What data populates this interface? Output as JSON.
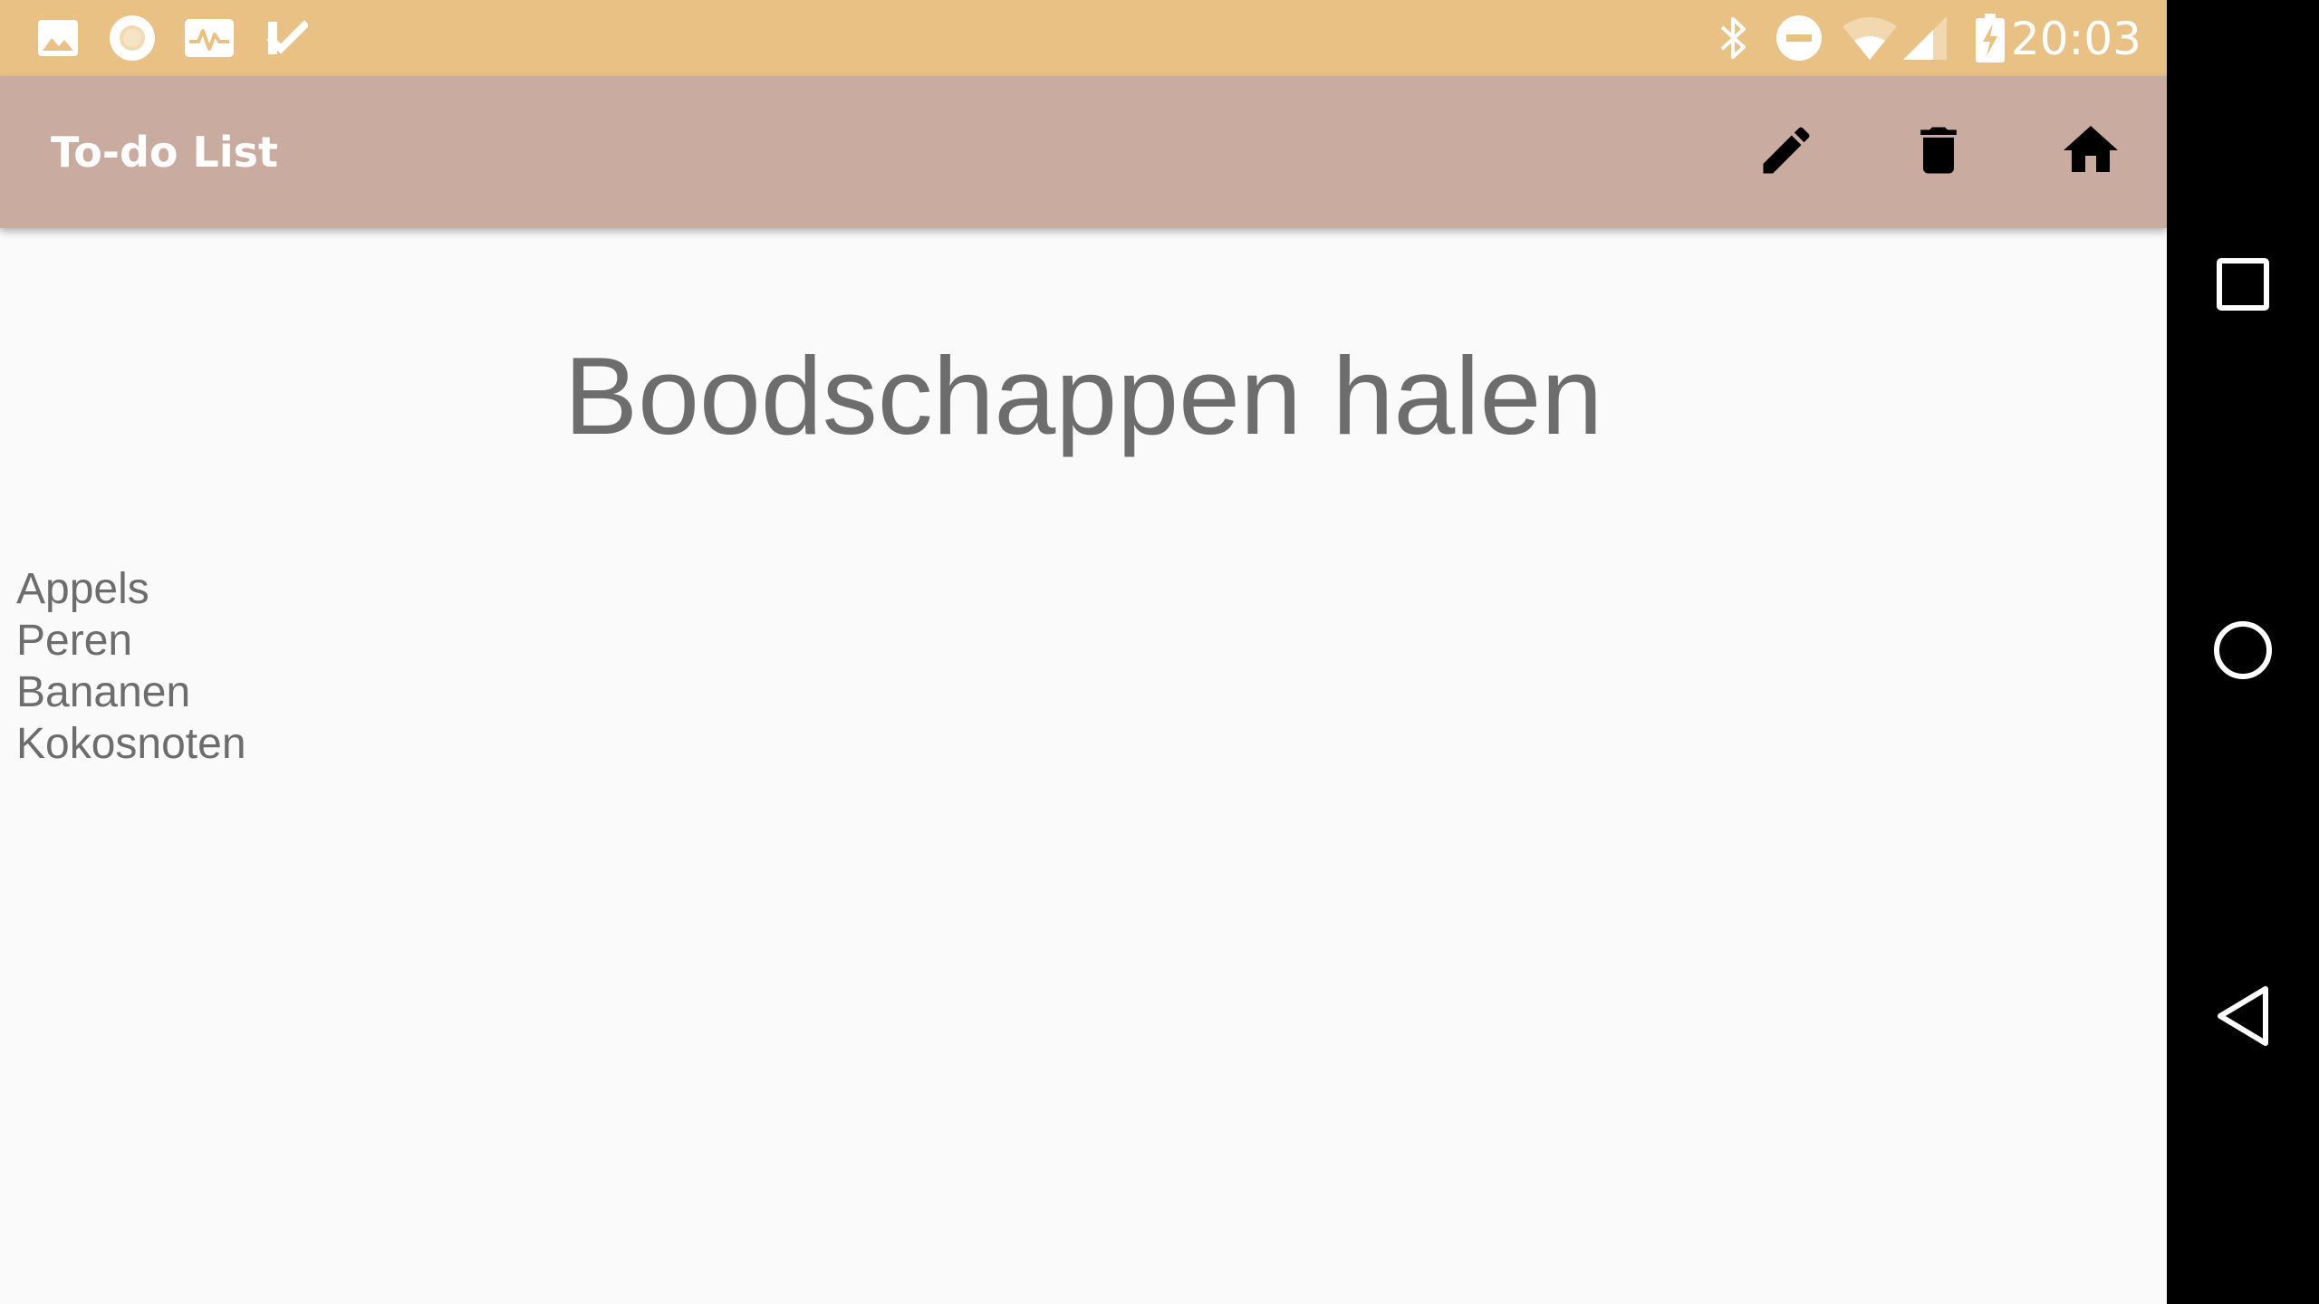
{
  "status_bar": {
    "time": "20:03",
    "left_icons": [
      "image-icon",
      "circle-notification-icon",
      "activity-chart-icon",
      "checklist-icon"
    ],
    "right_icons": [
      "bluetooth-icon",
      "do-not-disturb-icon",
      "wifi-icon",
      "cell-signal-icon",
      "battery-charging-icon"
    ],
    "background": "#e9c185"
  },
  "app_bar": {
    "title": "To-do List",
    "actions": [
      "pencil-icon",
      "trash-icon",
      "home-icon"
    ],
    "background": "#caaba0"
  },
  "list": {
    "title": "Boodschappen halen",
    "items": [
      "Appels",
      "Peren",
      "Bananen",
      "Kokosnoten"
    ]
  },
  "nav_bar": {
    "buttons": [
      "recents-square-icon",
      "home-circle-icon",
      "back-triangle-icon"
    ],
    "background": "#000000"
  }
}
